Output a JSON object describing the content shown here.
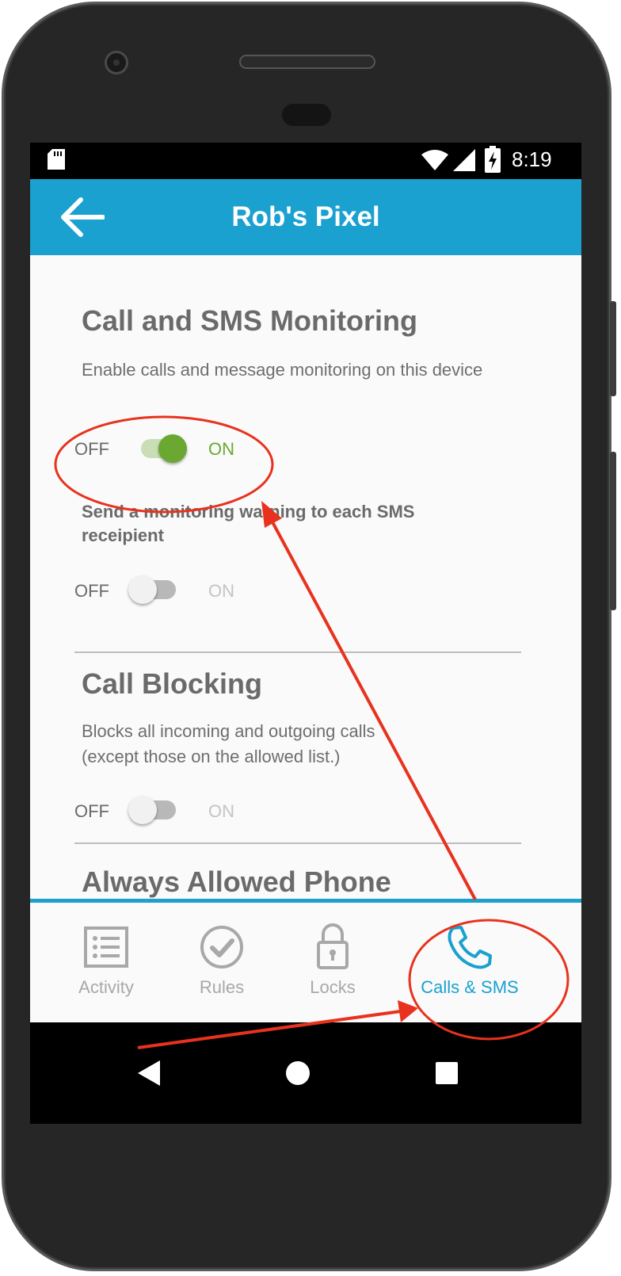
{
  "status_bar": {
    "time": "8:19",
    "icons": [
      "sd-card-icon",
      "wifi-icon",
      "signal-icon",
      "battery-charging-icon"
    ]
  },
  "app_bar": {
    "title": "Rob's Pixel",
    "back_icon": "arrow-left-icon"
  },
  "sections": {
    "monitoring": {
      "heading": "Call and SMS Monitoring",
      "description": "Enable calls and message monitoring on this device",
      "toggle": {
        "off_label": "OFF",
        "on_label": "ON",
        "enabled": true
      },
      "warning_text": "Send a monitoring warning to each SMS receipient",
      "warning_toggle": {
        "off_label": "OFF",
        "on_label": "ON",
        "enabled": false
      }
    },
    "blocking": {
      "heading": "Call Blocking",
      "description_line1": "Blocks all incoming and outgoing calls",
      "description_line2": "(except those on the allowed list.)",
      "toggle": {
        "off_label": "OFF",
        "on_label": "ON",
        "enabled": false
      }
    },
    "allowed": {
      "heading": "Always Allowed Phone"
    }
  },
  "bottom_nav": {
    "items": [
      {
        "label": "Activity",
        "icon": "activity-list-icon",
        "active": false
      },
      {
        "label": "Rules",
        "icon": "check-circle-icon",
        "active": false
      },
      {
        "label": "Locks",
        "icon": "padlock-icon",
        "active": false
      },
      {
        "label": "Calls & SMS",
        "icon": "phone-icon",
        "active": true
      }
    ]
  },
  "system_nav": {
    "icons": [
      "back-triangle-icon",
      "home-circle-icon",
      "recents-square-icon"
    ]
  },
  "colors": {
    "accent": "#1aa1cf",
    "toggle_on": "#6aa832",
    "annotation": "#e8321e"
  }
}
